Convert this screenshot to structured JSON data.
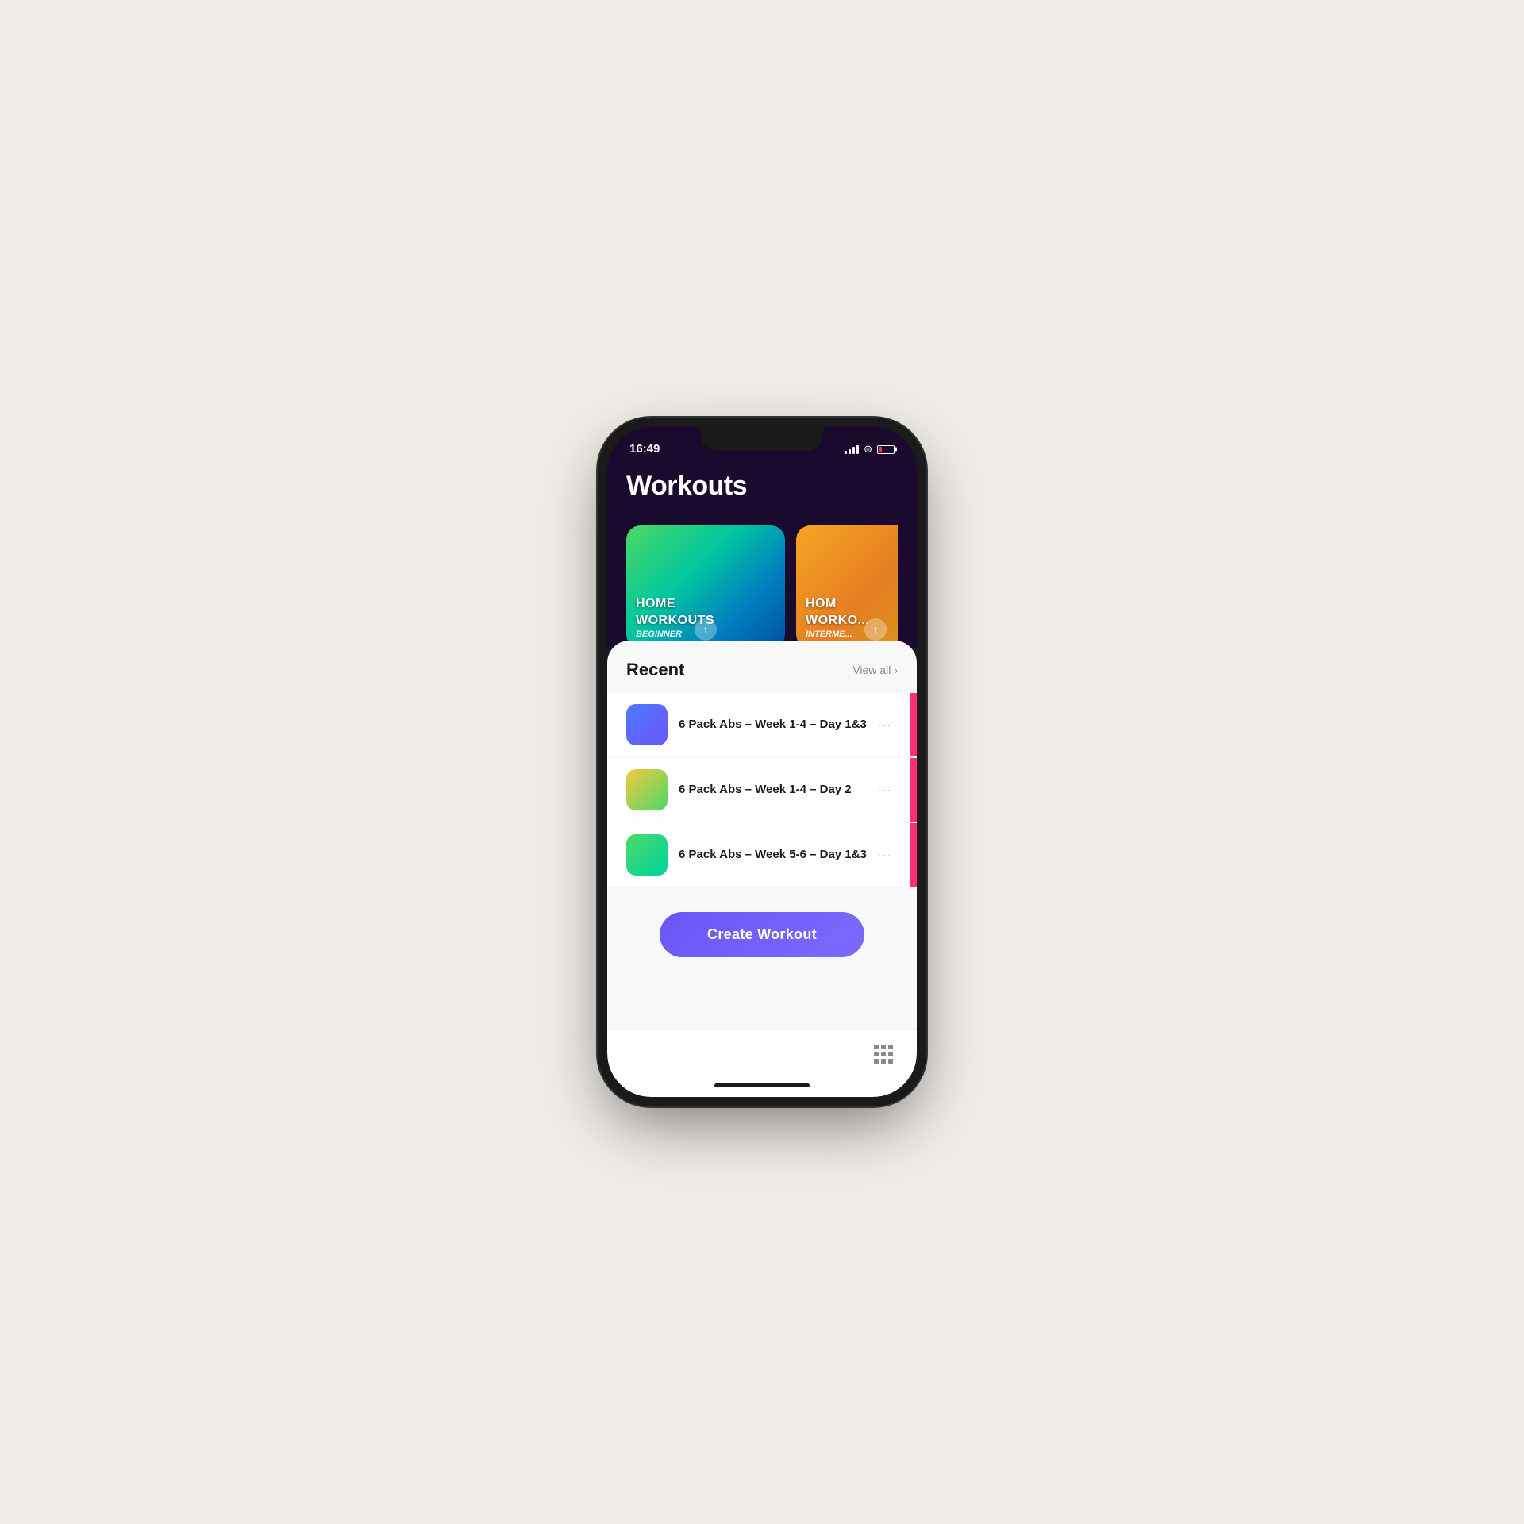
{
  "status_bar": {
    "time": "16:49",
    "signal_bars": [
      4,
      6,
      8,
      10
    ],
    "wifi": "wifi",
    "battery_level": "low"
  },
  "page": {
    "title": "Workouts"
  },
  "featured_cards": [
    {
      "id": "beginner",
      "line1": "HOME",
      "line2": "WORKOUTS",
      "line3": "BEGINNER",
      "gradient": "beginner"
    },
    {
      "id": "intermediate",
      "line1": "HOME",
      "line2": "WORKO...",
      "line3": "INTERME...",
      "gradient": "intermediate"
    }
  ],
  "recent_section": {
    "title": "Recent",
    "view_all_label": "View all"
  },
  "workouts": [
    {
      "id": 1,
      "name": "6 Pack Abs – Week 1-4 – Day 1&3",
      "thumbnail": "thumb-1",
      "menu_dots": "···"
    },
    {
      "id": 2,
      "name": "6 Pack Abs – Week 1-4 – Day 2",
      "thumbnail": "thumb-2",
      "menu_dots": "···"
    },
    {
      "id": 3,
      "name": "6 Pack Abs – Week 5-6 – Day 1&3",
      "thumbnail": "thumb-3",
      "menu_dots": "···"
    }
  ],
  "create_workout_button": {
    "label": "Create Workout"
  }
}
